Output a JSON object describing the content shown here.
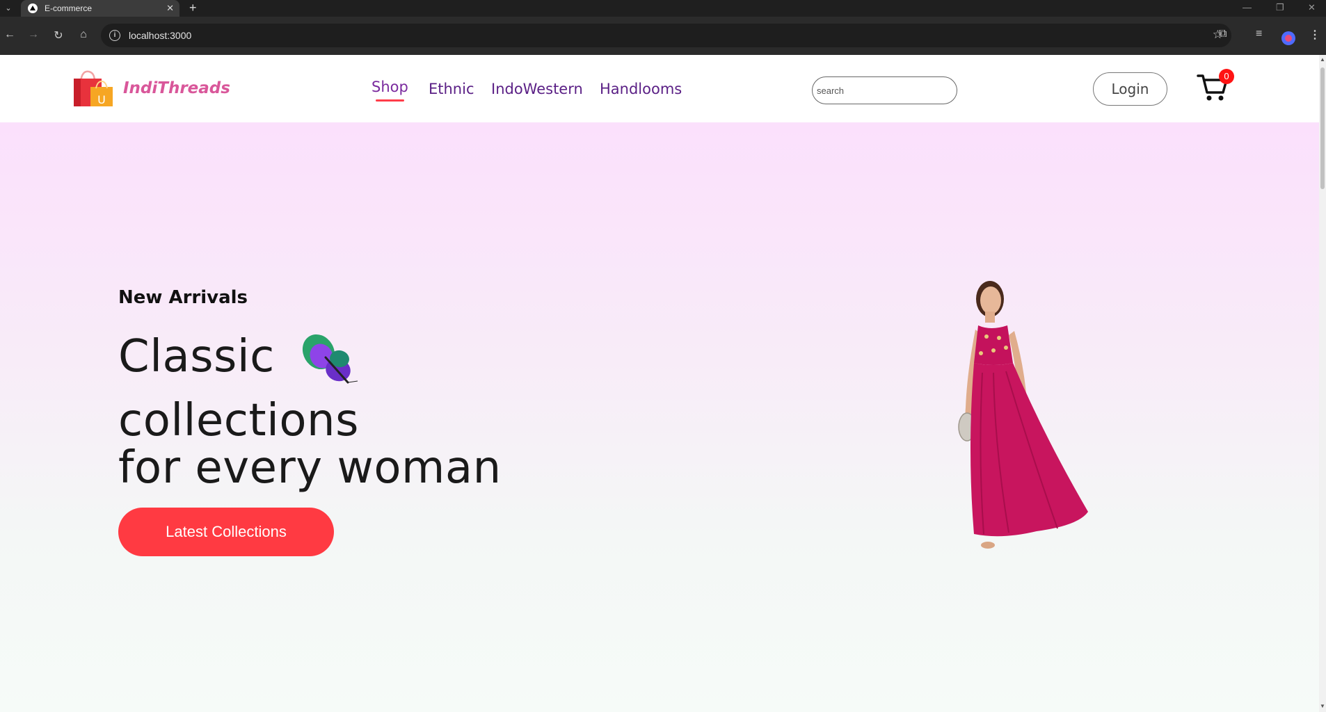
{
  "browser": {
    "tab_title": "E-commerce",
    "new_tab": "+",
    "url": "localhost:3000",
    "icons": {
      "tab_menu": "chevron-down-icon",
      "back": "arrow-left-icon",
      "forward": "arrow-right-icon",
      "reload": "reload-icon",
      "home": "home-icon",
      "site_info": "info-icon",
      "bookmark": "star-icon",
      "extensions": "puzzle-icon",
      "media": "media-icon",
      "profile": "avatar",
      "menu": "kebab-icon"
    }
  },
  "site": {
    "brand": "IndiThreads",
    "nav": [
      {
        "label": "Shop",
        "active": true
      },
      {
        "label": "Ethnic",
        "active": false
      },
      {
        "label": "IndoWestern",
        "active": false
      },
      {
        "label": "Handlooms",
        "active": false
      }
    ],
    "search": {
      "placeholder": "search",
      "value": ""
    },
    "login_label": "Login",
    "cart_count": "0"
  },
  "hero": {
    "eyebrow": "New Arrivals",
    "headline_line1": "Classic",
    "headline_line2": "collections",
    "headline_line3": "for every woman",
    "cta_label": "Latest Collections"
  },
  "colors": {
    "brand_pink": "#d9579a",
    "nav_purple": "#5a1f85",
    "accent_red": "#ff3a42",
    "badge_red": "#ff1313",
    "hero_top": "#fbe0fc",
    "hero_bottom": "#f6fbf8"
  }
}
